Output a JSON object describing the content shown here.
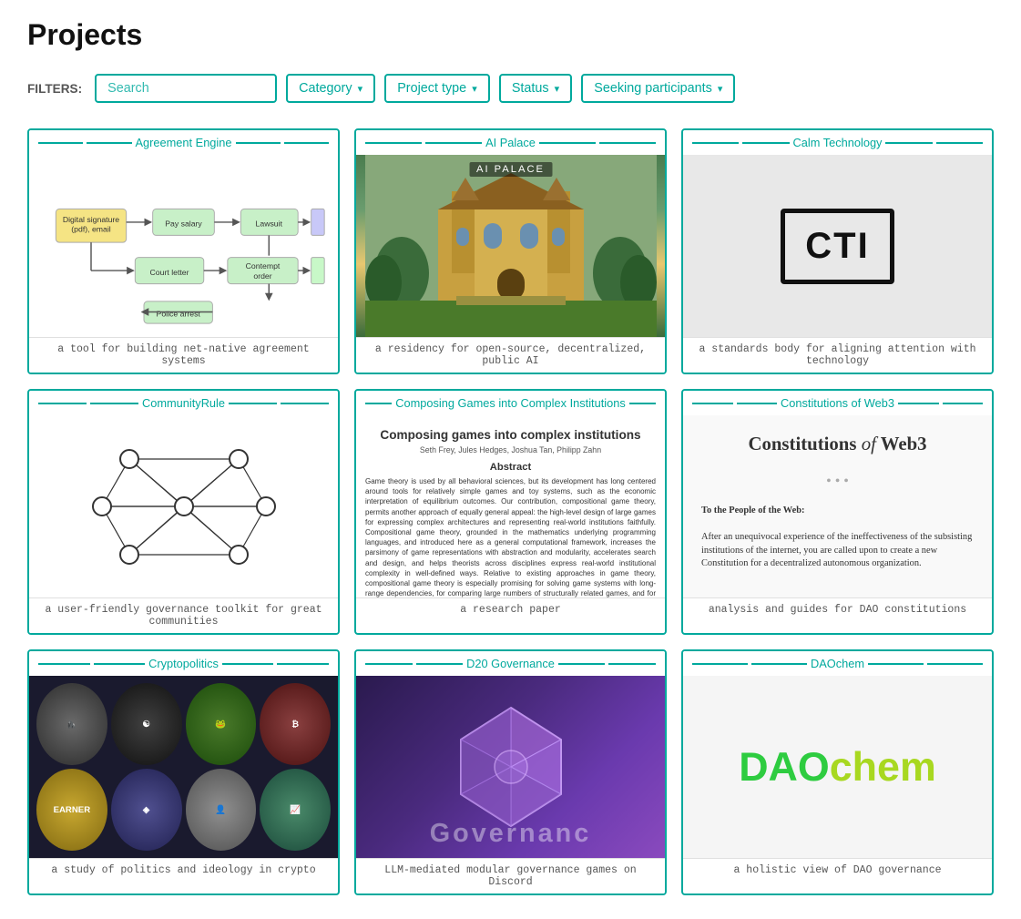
{
  "page": {
    "title": "Projects"
  },
  "filters": {
    "label": "FILTERS:",
    "search": {
      "placeholder": "Search",
      "value": ""
    },
    "dropdowns": [
      {
        "id": "category",
        "label": "Category",
        "icon": "chevron-down-icon"
      },
      {
        "id": "project-type",
        "label": "Project type",
        "icon": "chevron-down-icon"
      },
      {
        "id": "status",
        "label": "Status",
        "icon": "chevron-down-icon"
      },
      {
        "id": "seeking-participants",
        "label": "Seeking participants",
        "icon": "chevron-down-icon"
      }
    ]
  },
  "projects": [
    {
      "id": "agreement-engine",
      "title": "Agreement Engine",
      "description": "a tool for building net-native agreement systems",
      "type": "diagram"
    },
    {
      "id": "ai-palace",
      "title": "AI Palace",
      "description": "a residency for open-source, decentralized, public AI",
      "type": "photo"
    },
    {
      "id": "calm-technology",
      "title": "Calm Technology",
      "description": "a standards body for aligning attention with technology",
      "type": "logo"
    },
    {
      "id": "community-rule",
      "title": "CommunityRule",
      "description": "a user-friendly governance toolkit for great communities",
      "type": "network"
    },
    {
      "id": "composing-games",
      "title": "Composing Games into Complex Institutions",
      "description": "a research paper",
      "type": "paper"
    },
    {
      "id": "constitutions-web3",
      "title": "Constitutions of Web3",
      "description": "analysis and guides for DAO constitutions",
      "type": "doc"
    },
    {
      "id": "cryptopolitics",
      "title": "Cryptopolitics",
      "description": "a study of politics and ideology in crypto",
      "type": "memes"
    },
    {
      "id": "d20-governance",
      "title": "D20 Governance",
      "description": "LLM-mediated modular governance games on Discord",
      "type": "gradient"
    },
    {
      "id": "daochem",
      "title": "DAOchem",
      "description": "a holistic view of DAO governance",
      "type": "brand"
    }
  ],
  "paper": {
    "title": "Composing games into complex institutions",
    "authors": "Seth Frey, Jules Hedges, Joshua Tan, Philipp Zahn",
    "abstract_label": "Abstract",
    "abstract_text": "Game theory is used by all behavioral sciences, but its development has long centered around tools for relatively simple games and toy systems, such as the economic interpretation of equilibrium outcomes. Our contribution, compositional game theory, permits another approach of equally general appeal: the high-level design of large games for expressing complex architectures and representing real-world institutions faithfully. Compositional game theory, grounded in the mathematics underlying programming languages, and introduced here as a general computational framework, increases the parsimony of game representations with abstraction and modularity, accelerates search and design, and helps theorists across disciplines express real-world institutional complexity in well-defined ways. Relative to existing approaches in game theory, compositional game theory is especially promising for solving game systems with long-range dependencies, for comparing large numbers of structurally related games, and for nesting games into the larger logical or strategic flows typical of real world policy or institutional settings."
  },
  "constitutions": {
    "title": "Constitutions",
    "italic": "of",
    "subtitle": "Web3",
    "dots": "• • •",
    "heading": "To the People of the Web:",
    "body": "After an unequivocal experience of the ineffectiveness of the subsisting institutions of the internet, you are called upon to create a new Constitution for a decentralized autonomous organization."
  }
}
